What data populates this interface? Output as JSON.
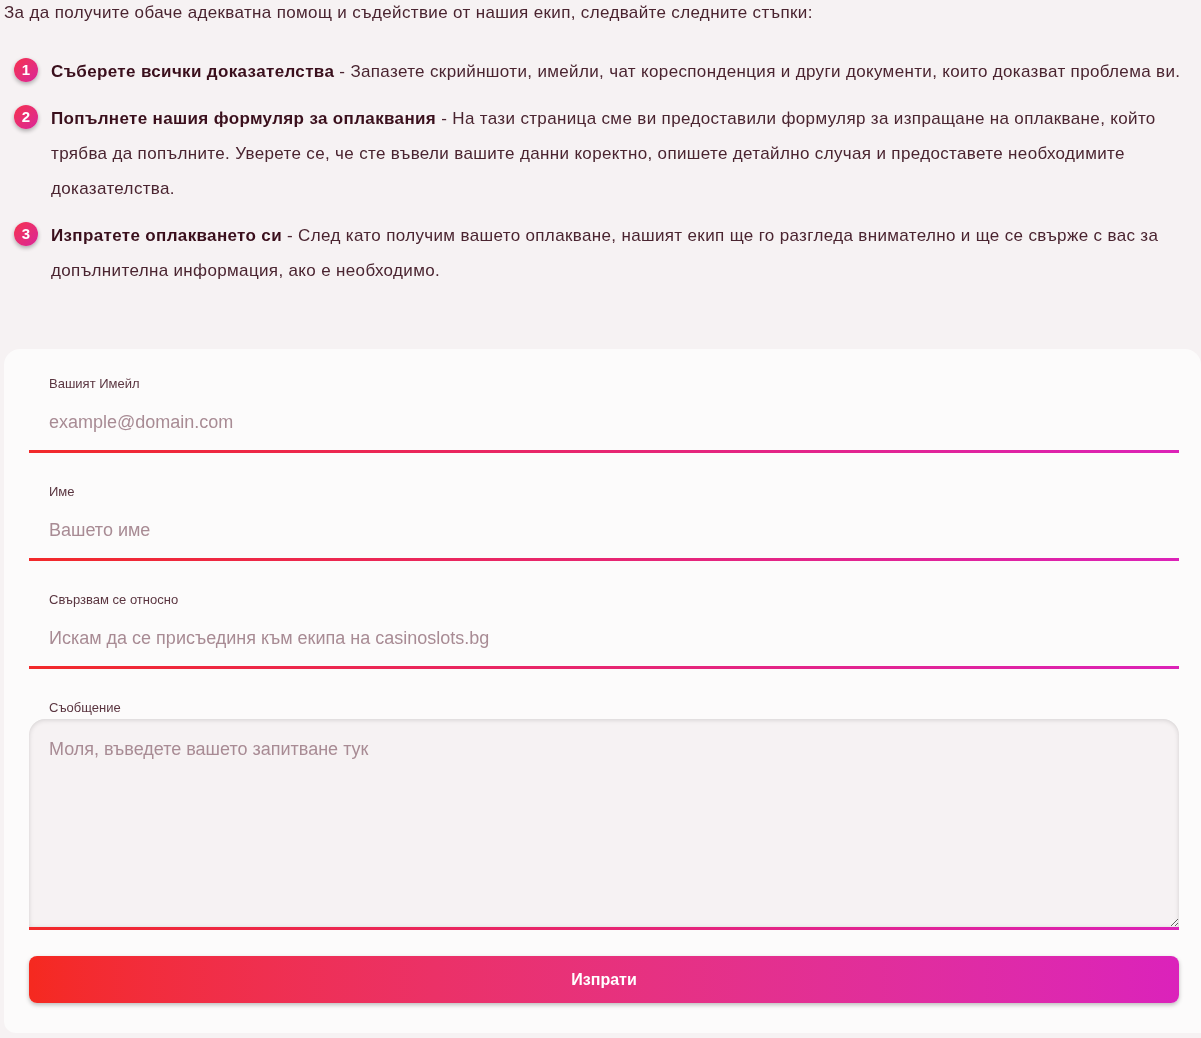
{
  "intro": "За да получите обаче адекватна помощ и съдействие от нашия екип, следвайте следните стъпки:",
  "steps": [
    {
      "number": "1",
      "text": "**Съберете всички доказателства** - Запазете скрийншоти, имейли, чат кореспонденция и други документи, които доказват проблема ви."
    },
    {
      "number": "2",
      "text": "**Попълнете нашия формуляр за оплаквания** - На тази страница сме ви предоставили формуляр за изпращане на оплакване, който трябва да попълните. Уверете се, че сте въвели вашите данни коректно, опишете детайлно случая и предоставете необходимите доказателства."
    },
    {
      "number": "3",
      "text": "**Изпратете оплакването си** - След като получим вашето оплакване, нашият екип ще го разгледа внимателно и ще се свърже с вас за допълнителна информация, ако е необходимо."
    }
  ],
  "form": {
    "fields": [
      {
        "kind": "input",
        "label": "Вашият Имейл",
        "placeholder": "example@domain.com"
      },
      {
        "kind": "input",
        "label": "Име",
        "placeholder": "Вашето име"
      },
      {
        "kind": "input",
        "label": "Свързвам се относно",
        "placeholder": "Искам да се присъединя към екипа на casinoslots.bg"
      },
      {
        "kind": "textarea",
        "label": "Съобщение",
        "placeholder": "Моля, въведете вашето запитване тук"
      }
    ],
    "submit": "Изпрати"
  }
}
